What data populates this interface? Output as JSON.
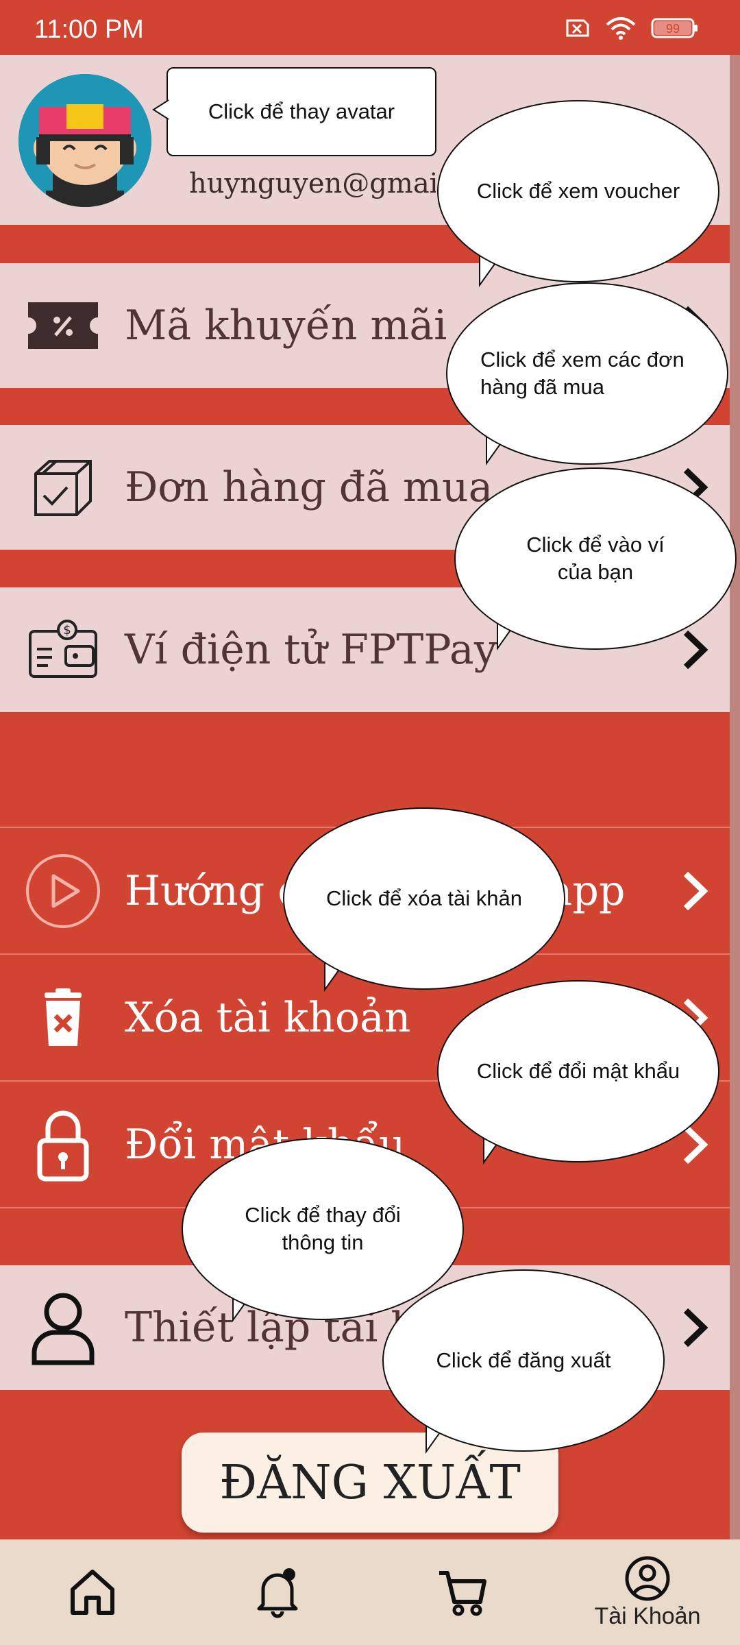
{
  "status": {
    "time": "11:00 PM",
    "battery": "99"
  },
  "profile": {
    "email": "huynguyen@gmail.com"
  },
  "menu": {
    "voucher": "Mã khuyến mãi",
    "orders": "Đơn hàng đã mua",
    "wallet": "Ví điện tử FPTPay",
    "guide": "Hướng dẫn sử dụng app",
    "delete": "Xóa tài khoản",
    "password": "Đổi mật khẩu",
    "settings": "Thiết lập tài khoản"
  },
  "logout_label": "ĐĂNG XUẤT",
  "nav": {
    "account": "Tài Khoản"
  },
  "tooltips": {
    "avatar": "Click để thay avatar",
    "voucher": "Click để xem voucher",
    "orders": "Click để xem các đơn hàng đã mua",
    "wallet": "Click để vào ví của bạn",
    "delete": "Click để xóa tài khản",
    "password": "Click để đổi mật khẩu",
    "info": "Click để thay đổi thông tin",
    "logout": "Click để đăng xuất"
  },
  "colors": {
    "accent": "#D24432",
    "row_bg": "#EBD3D3",
    "nav_bg": "#EADACB",
    "button_bg": "#FCEFE3"
  }
}
